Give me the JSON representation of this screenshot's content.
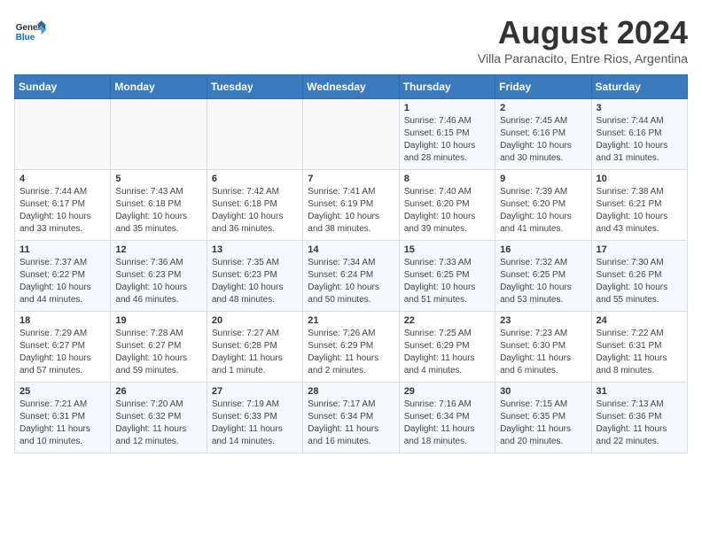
{
  "header": {
    "logo_line1": "General",
    "logo_line2": "Blue",
    "month": "August 2024",
    "location": "Villa Paranacito, Entre Rios, Argentina"
  },
  "weekdays": [
    "Sunday",
    "Monday",
    "Tuesday",
    "Wednesday",
    "Thursday",
    "Friday",
    "Saturday"
  ],
  "weeks": [
    [
      {
        "day": "",
        "text": ""
      },
      {
        "day": "",
        "text": ""
      },
      {
        "day": "",
        "text": ""
      },
      {
        "day": "",
        "text": ""
      },
      {
        "day": "1",
        "text": "Sunrise: 7:46 AM\nSunset: 6:15 PM\nDaylight: 10 hours and 28 minutes."
      },
      {
        "day": "2",
        "text": "Sunrise: 7:45 AM\nSunset: 6:16 PM\nDaylight: 10 hours and 30 minutes."
      },
      {
        "day": "3",
        "text": "Sunrise: 7:44 AM\nSunset: 6:16 PM\nDaylight: 10 hours and 31 minutes."
      }
    ],
    [
      {
        "day": "4",
        "text": "Sunrise: 7:44 AM\nSunset: 6:17 PM\nDaylight: 10 hours and 33 minutes."
      },
      {
        "day": "5",
        "text": "Sunrise: 7:43 AM\nSunset: 6:18 PM\nDaylight: 10 hours and 35 minutes."
      },
      {
        "day": "6",
        "text": "Sunrise: 7:42 AM\nSunset: 6:18 PM\nDaylight: 10 hours and 36 minutes."
      },
      {
        "day": "7",
        "text": "Sunrise: 7:41 AM\nSunset: 6:19 PM\nDaylight: 10 hours and 38 minutes."
      },
      {
        "day": "8",
        "text": "Sunrise: 7:40 AM\nSunset: 6:20 PM\nDaylight: 10 hours and 39 minutes."
      },
      {
        "day": "9",
        "text": "Sunrise: 7:39 AM\nSunset: 6:20 PM\nDaylight: 10 hours and 41 minutes."
      },
      {
        "day": "10",
        "text": "Sunrise: 7:38 AM\nSunset: 6:21 PM\nDaylight: 10 hours and 43 minutes."
      }
    ],
    [
      {
        "day": "11",
        "text": "Sunrise: 7:37 AM\nSunset: 6:22 PM\nDaylight: 10 hours and 44 minutes."
      },
      {
        "day": "12",
        "text": "Sunrise: 7:36 AM\nSunset: 6:23 PM\nDaylight: 10 hours and 46 minutes."
      },
      {
        "day": "13",
        "text": "Sunrise: 7:35 AM\nSunset: 6:23 PM\nDaylight: 10 hours and 48 minutes."
      },
      {
        "day": "14",
        "text": "Sunrise: 7:34 AM\nSunset: 6:24 PM\nDaylight: 10 hours and 50 minutes."
      },
      {
        "day": "15",
        "text": "Sunrise: 7:33 AM\nSunset: 6:25 PM\nDaylight: 10 hours and 51 minutes."
      },
      {
        "day": "16",
        "text": "Sunrise: 7:32 AM\nSunset: 6:25 PM\nDaylight: 10 hours and 53 minutes."
      },
      {
        "day": "17",
        "text": "Sunrise: 7:30 AM\nSunset: 6:26 PM\nDaylight: 10 hours and 55 minutes."
      }
    ],
    [
      {
        "day": "18",
        "text": "Sunrise: 7:29 AM\nSunset: 6:27 PM\nDaylight: 10 hours and 57 minutes."
      },
      {
        "day": "19",
        "text": "Sunrise: 7:28 AM\nSunset: 6:27 PM\nDaylight: 10 hours and 59 minutes."
      },
      {
        "day": "20",
        "text": "Sunrise: 7:27 AM\nSunset: 6:28 PM\nDaylight: 11 hours and 1 minute."
      },
      {
        "day": "21",
        "text": "Sunrise: 7:26 AM\nSunset: 6:29 PM\nDaylight: 11 hours and 2 minutes."
      },
      {
        "day": "22",
        "text": "Sunrise: 7:25 AM\nSunset: 6:29 PM\nDaylight: 11 hours and 4 minutes."
      },
      {
        "day": "23",
        "text": "Sunrise: 7:23 AM\nSunset: 6:30 PM\nDaylight: 11 hours and 6 minutes."
      },
      {
        "day": "24",
        "text": "Sunrise: 7:22 AM\nSunset: 6:31 PM\nDaylight: 11 hours and 8 minutes."
      }
    ],
    [
      {
        "day": "25",
        "text": "Sunrise: 7:21 AM\nSunset: 6:31 PM\nDaylight: 11 hours and 10 minutes."
      },
      {
        "day": "26",
        "text": "Sunrise: 7:20 AM\nSunset: 6:32 PM\nDaylight: 11 hours and 12 minutes."
      },
      {
        "day": "27",
        "text": "Sunrise: 7:19 AM\nSunset: 6:33 PM\nDaylight: 11 hours and 14 minutes."
      },
      {
        "day": "28",
        "text": "Sunrise: 7:17 AM\nSunset: 6:34 PM\nDaylight: 11 hours and 16 minutes."
      },
      {
        "day": "29",
        "text": "Sunrise: 7:16 AM\nSunset: 6:34 PM\nDaylight: 11 hours and 18 minutes."
      },
      {
        "day": "30",
        "text": "Sunrise: 7:15 AM\nSunset: 6:35 PM\nDaylight: 11 hours and 20 minutes."
      },
      {
        "day": "31",
        "text": "Sunrise: 7:13 AM\nSunset: 6:36 PM\nDaylight: 11 hours and 22 minutes."
      }
    ]
  ]
}
